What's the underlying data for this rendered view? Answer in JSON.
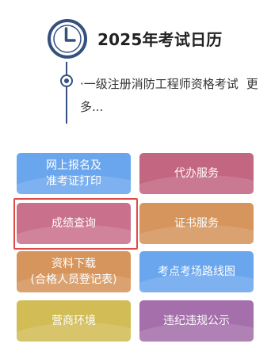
{
  "calendar": {
    "title": "2025年考试日历",
    "events": [
      {
        "prefix": "·",
        "text": "一级注册消防工程师资格考试",
        "more": "更多..."
      }
    ]
  },
  "tiles": [
    {
      "label_lines": [
        "网上报名及",
        "准考证打印"
      ]
    },
    {
      "label_lines": [
        "代办服务"
      ]
    },
    {
      "label_lines": [
        "成绩查询"
      ]
    },
    {
      "label_lines": [
        "证书服务"
      ]
    },
    {
      "label_lines": [
        "资料下载",
        "(合格人员登记表)"
      ]
    },
    {
      "label_lines": [
        "考点考场路线图"
      ]
    },
    {
      "label_lines": [
        "营商环境"
      ]
    },
    {
      "label_lines": [
        "违纪违规公示"
      ]
    }
  ],
  "colors": {
    "accent_navy": "#34507f",
    "tile_blue": "#6aa6ee",
    "tile_pink": "#c36682",
    "tile_rose": "#c9718c",
    "tile_orange": "#d6955c",
    "tile_yellow": "#d1bc55",
    "tile_purple": "#a56fab",
    "highlight_red": "#e04b46"
  },
  "icons": {
    "calendar_icon": "clock-icon",
    "timeline_marker": "timeline-dot"
  }
}
